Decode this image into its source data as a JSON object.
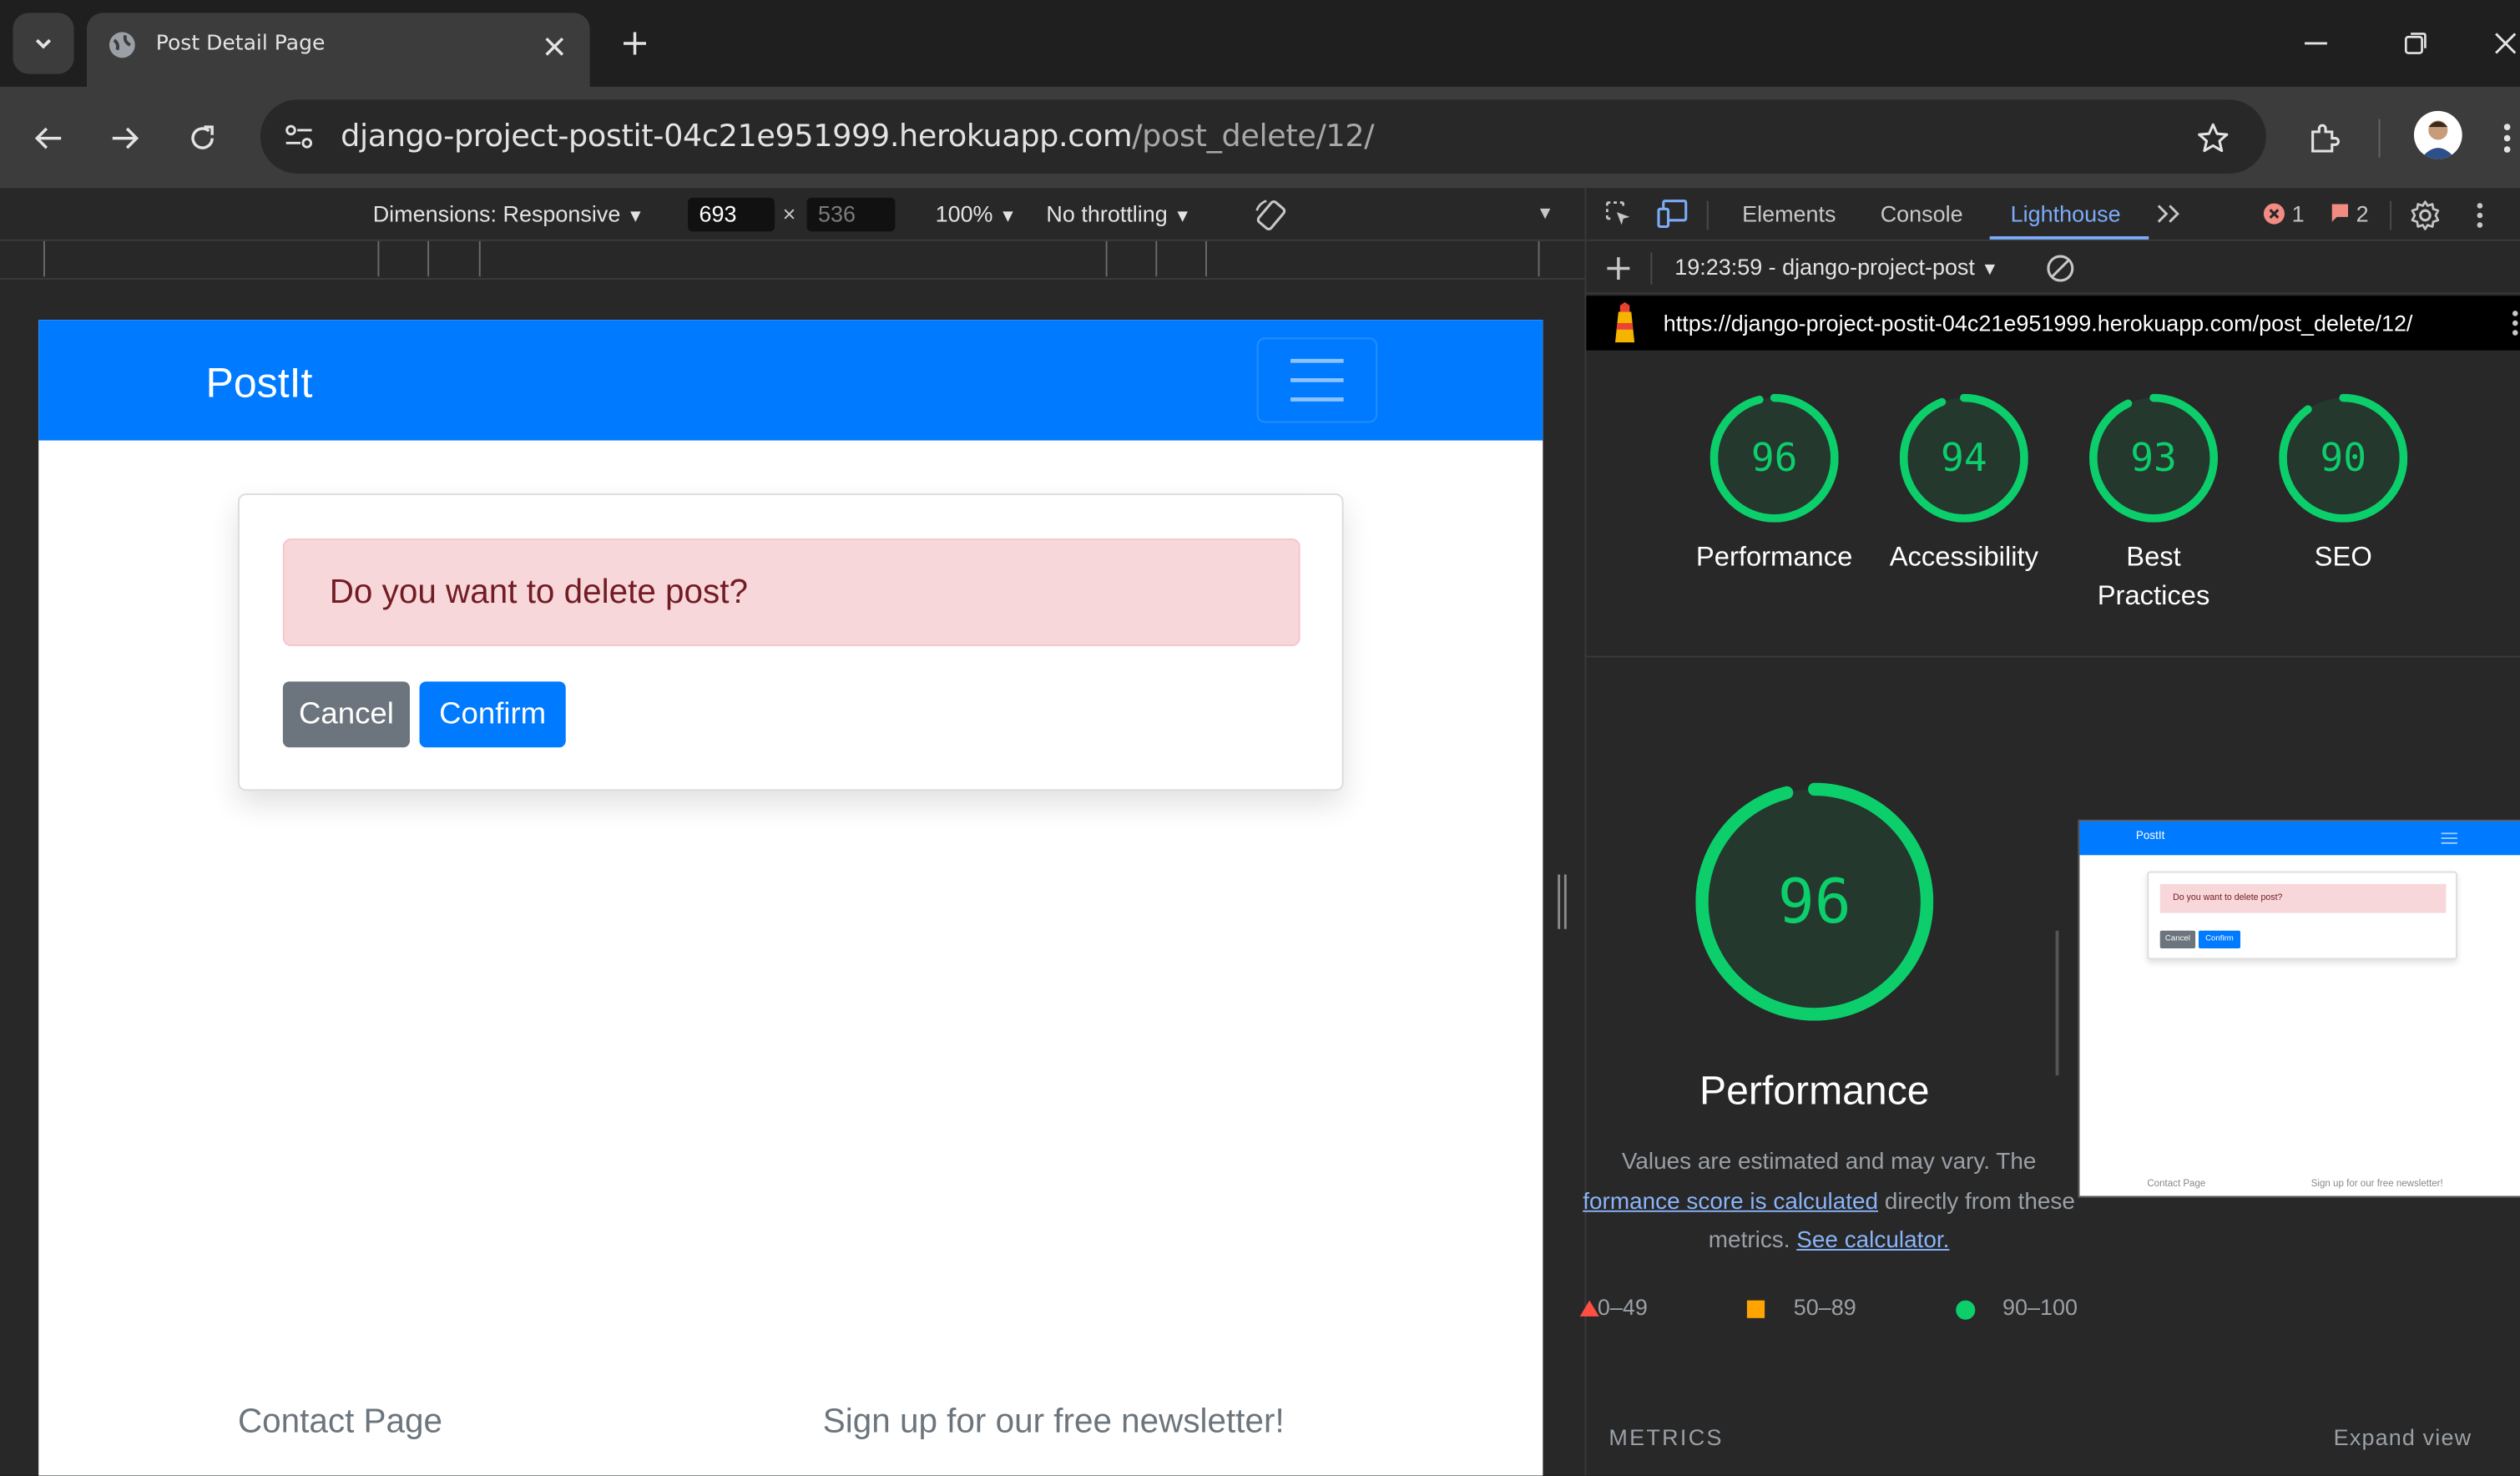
{
  "browser": {
    "tab_title": "Post Detail Page",
    "url_host": "django-project-postit-04c21e951999.herokuapp.com",
    "url_path": "/post_delete/12/"
  },
  "device_toolbar": {
    "dimensions_label": "Dimensions: Responsive",
    "width": "693",
    "times": "×",
    "height": "536",
    "zoom": "100%",
    "throttling": "No throttling"
  },
  "page": {
    "brand": "PostIt",
    "alert_text": "Do you want to delete post?",
    "cancel_label": "Cancel",
    "confirm_label": "Confirm",
    "footer_contact": "Contact Page",
    "footer_newsletter": "Sign up for our free newsletter!",
    "colors": {
      "primary": "#007bff",
      "secondary": "#6c757d",
      "alert_bg": "#f8d7da",
      "alert_text": "#721c24"
    }
  },
  "devtools": {
    "tabs": [
      "Elements",
      "Console",
      "Lighthouse"
    ],
    "active_tab": "Lighthouse",
    "error_count": "1",
    "issue_count": "2",
    "report_selector": "19:23:59 - django-project-post",
    "report_url": "https://django-project-postit-04c21e951999.herokuapp.com/post_delete/12/",
    "scores": [
      {
        "label": "Performance",
        "value": 96
      },
      {
        "label": "Accessibility",
        "value": 94
      },
      {
        "label": "Best\nPractices",
        "value": 93
      },
      {
        "label": "SEO",
        "value": 90
      }
    ],
    "main_score": {
      "label": "Performance",
      "value": 96
    },
    "desc_1": "Values are estimated and may vary. The",
    "desc_link_1": "formance score is calculated",
    "desc_2": "directly from these",
    "desc_3": "metrics.",
    "desc_link_2": "See calculator.",
    "legend": [
      "0–49",
      "50–89",
      "90–100"
    ],
    "metrics_label": "METRICS",
    "expand_label": "Expand view",
    "thumb": {
      "brand": "PostIt",
      "alert_text": "Do you want to delete post?",
      "cancel_label": "Cancel",
      "confirm_label": "Confirm",
      "footer_contact": "Contact Page",
      "footer_newsletter": "Sign up for our free newsletter!"
    },
    "colors": {
      "pass": "#0cce6b",
      "average": "#ffa400",
      "fail": "#ff4e42"
    }
  }
}
